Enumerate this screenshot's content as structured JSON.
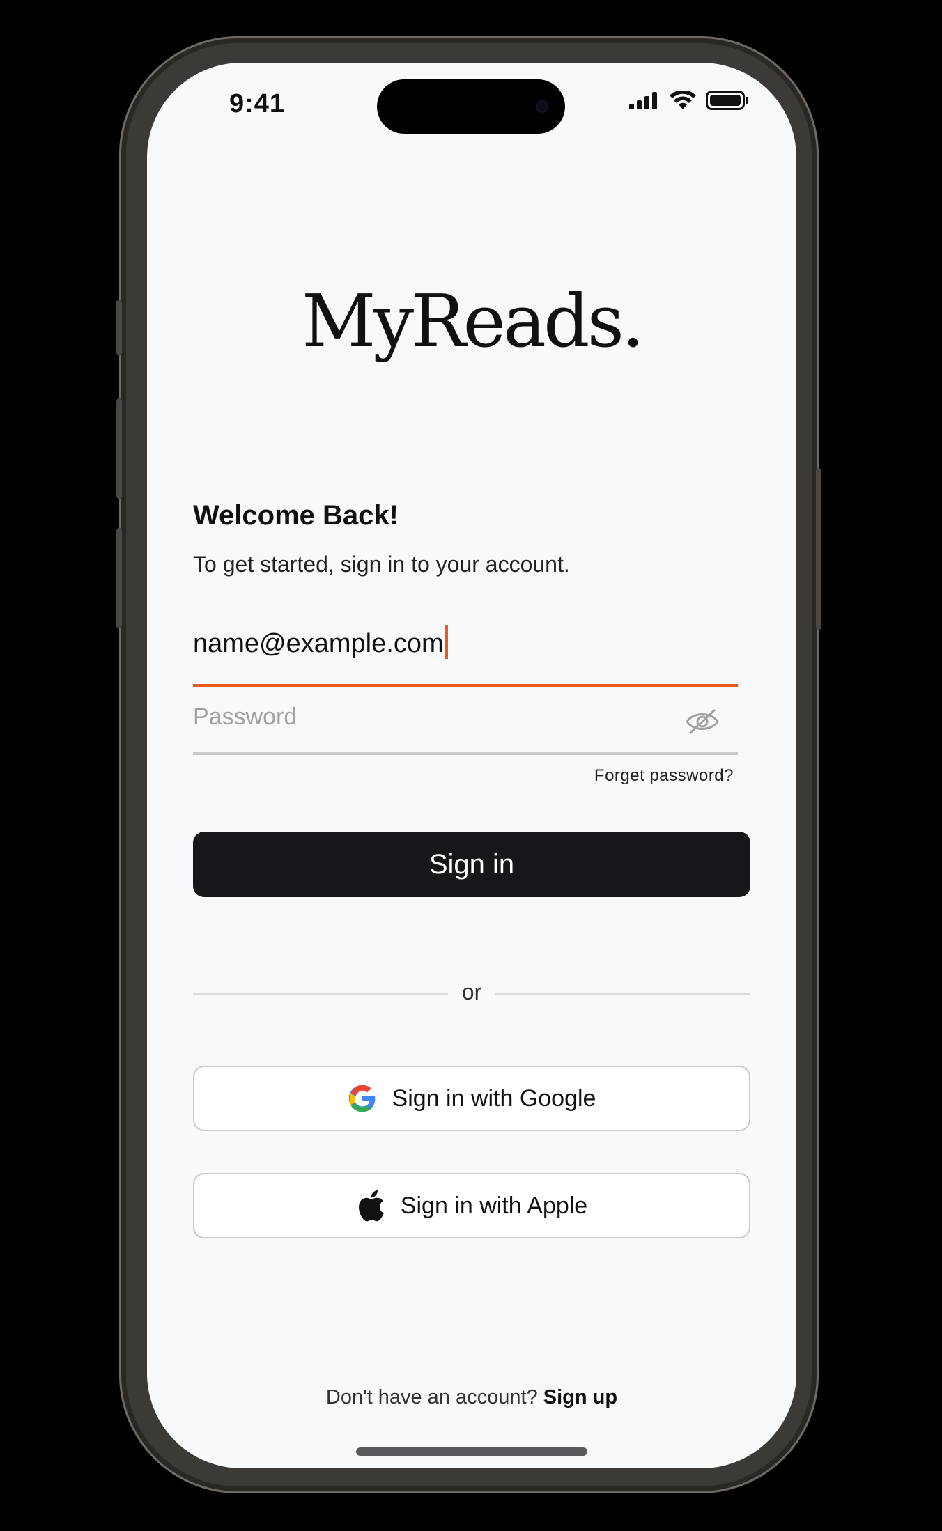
{
  "status_bar": {
    "time": "9:41"
  },
  "app": {
    "logo": "MyReads."
  },
  "welcome": {
    "title": "Welcome Back!",
    "subtitle": "To get started, sign in to your account."
  },
  "form": {
    "email_value": "name@example.com",
    "password_placeholder": "Password",
    "forgot_password": "Forget password?",
    "sign_in_label": "Sign in"
  },
  "divider": {
    "text": "or"
  },
  "social": {
    "google_label": "Sign in with Google",
    "apple_label": "Sign in with Apple"
  },
  "footer": {
    "prompt": "Don't have an account?",
    "signup_link": "Sign up"
  },
  "colors": {
    "accent": "#ea5b19",
    "primary_button": "#16171b",
    "background": "#f8f9fa"
  },
  "icons": [
    "signal-icon",
    "wifi-icon",
    "battery-icon",
    "eye-off-icon",
    "google-icon",
    "apple-icon"
  ]
}
